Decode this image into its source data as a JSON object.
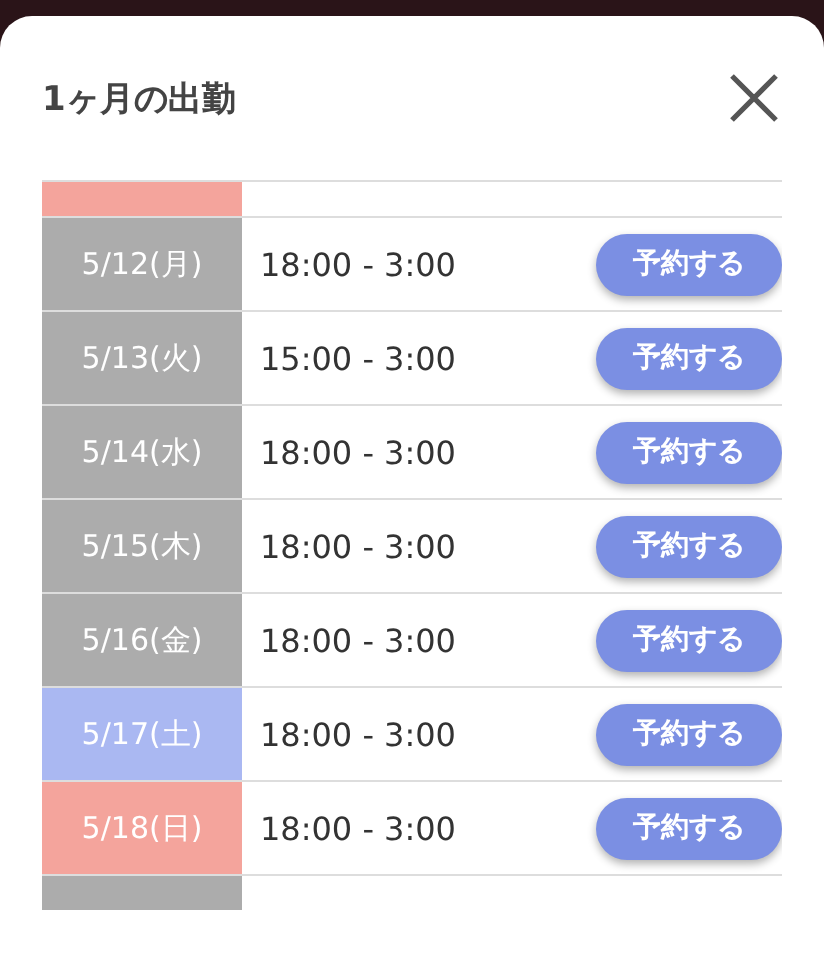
{
  "title": "1ヶ月の出勤",
  "clipped_row_above": {
    "kind": "sunday"
  },
  "rows": [
    {
      "date": "5/12(月)",
      "kind": "weekday",
      "hours": "18:00 - 3:00",
      "button": "予約する"
    },
    {
      "date": "5/13(火)",
      "kind": "weekday",
      "hours": "15:00 - 3:00",
      "button": "予約する"
    },
    {
      "date": "5/14(水)",
      "kind": "weekday",
      "hours": "18:00 - 3:00",
      "button": "予約する"
    },
    {
      "date": "5/15(木)",
      "kind": "weekday",
      "hours": "18:00 - 3:00",
      "button": "予約する"
    },
    {
      "date": "5/16(金)",
      "kind": "weekday",
      "hours": "18:00 - 3:00",
      "button": "予約する"
    },
    {
      "date": "5/17(土)",
      "kind": "saturday",
      "hours": "18:00 - 3:00",
      "button": "予約する"
    },
    {
      "date": "5/18(日)",
      "kind": "sunday",
      "hours": "18:00 - 3:00",
      "button": "予約する"
    }
  ],
  "clipped_row_below": {
    "kind": "weekday"
  }
}
